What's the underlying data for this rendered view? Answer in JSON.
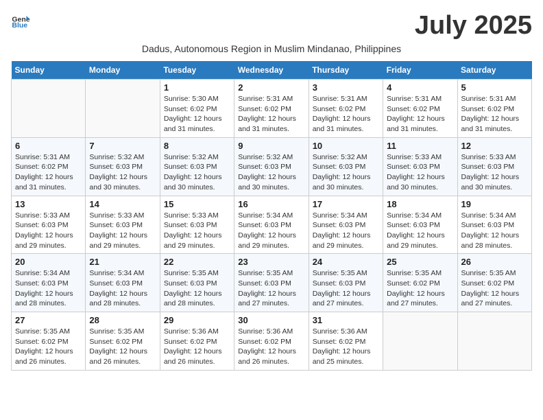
{
  "header": {
    "logo_general": "General",
    "logo_blue": "Blue",
    "title": "July 2025",
    "subtitle": "Dadus, Autonomous Region in Muslim Mindanao, Philippines"
  },
  "days_of_week": [
    "Sunday",
    "Monday",
    "Tuesday",
    "Wednesday",
    "Thursday",
    "Friday",
    "Saturday"
  ],
  "weeks": [
    [
      {
        "day": "",
        "info": ""
      },
      {
        "day": "",
        "info": ""
      },
      {
        "day": "1",
        "info": "Sunrise: 5:30 AM\nSunset: 6:02 PM\nDaylight: 12 hours and 31 minutes."
      },
      {
        "day": "2",
        "info": "Sunrise: 5:31 AM\nSunset: 6:02 PM\nDaylight: 12 hours and 31 minutes."
      },
      {
        "day": "3",
        "info": "Sunrise: 5:31 AM\nSunset: 6:02 PM\nDaylight: 12 hours and 31 minutes."
      },
      {
        "day": "4",
        "info": "Sunrise: 5:31 AM\nSunset: 6:02 PM\nDaylight: 12 hours and 31 minutes."
      },
      {
        "day": "5",
        "info": "Sunrise: 5:31 AM\nSunset: 6:02 PM\nDaylight: 12 hours and 31 minutes."
      }
    ],
    [
      {
        "day": "6",
        "info": "Sunrise: 5:31 AM\nSunset: 6:02 PM\nDaylight: 12 hours and 31 minutes."
      },
      {
        "day": "7",
        "info": "Sunrise: 5:32 AM\nSunset: 6:03 PM\nDaylight: 12 hours and 30 minutes."
      },
      {
        "day": "8",
        "info": "Sunrise: 5:32 AM\nSunset: 6:03 PM\nDaylight: 12 hours and 30 minutes."
      },
      {
        "day": "9",
        "info": "Sunrise: 5:32 AM\nSunset: 6:03 PM\nDaylight: 12 hours and 30 minutes."
      },
      {
        "day": "10",
        "info": "Sunrise: 5:32 AM\nSunset: 6:03 PM\nDaylight: 12 hours and 30 minutes."
      },
      {
        "day": "11",
        "info": "Sunrise: 5:33 AM\nSunset: 6:03 PM\nDaylight: 12 hours and 30 minutes."
      },
      {
        "day": "12",
        "info": "Sunrise: 5:33 AM\nSunset: 6:03 PM\nDaylight: 12 hours and 30 minutes."
      }
    ],
    [
      {
        "day": "13",
        "info": "Sunrise: 5:33 AM\nSunset: 6:03 PM\nDaylight: 12 hours and 29 minutes."
      },
      {
        "day": "14",
        "info": "Sunrise: 5:33 AM\nSunset: 6:03 PM\nDaylight: 12 hours and 29 minutes."
      },
      {
        "day": "15",
        "info": "Sunrise: 5:33 AM\nSunset: 6:03 PM\nDaylight: 12 hours and 29 minutes."
      },
      {
        "day": "16",
        "info": "Sunrise: 5:34 AM\nSunset: 6:03 PM\nDaylight: 12 hours and 29 minutes."
      },
      {
        "day": "17",
        "info": "Sunrise: 5:34 AM\nSunset: 6:03 PM\nDaylight: 12 hours and 29 minutes."
      },
      {
        "day": "18",
        "info": "Sunrise: 5:34 AM\nSunset: 6:03 PM\nDaylight: 12 hours and 29 minutes."
      },
      {
        "day": "19",
        "info": "Sunrise: 5:34 AM\nSunset: 6:03 PM\nDaylight: 12 hours and 28 minutes."
      }
    ],
    [
      {
        "day": "20",
        "info": "Sunrise: 5:34 AM\nSunset: 6:03 PM\nDaylight: 12 hours and 28 minutes."
      },
      {
        "day": "21",
        "info": "Sunrise: 5:34 AM\nSunset: 6:03 PM\nDaylight: 12 hours and 28 minutes."
      },
      {
        "day": "22",
        "info": "Sunrise: 5:35 AM\nSunset: 6:03 PM\nDaylight: 12 hours and 28 minutes."
      },
      {
        "day": "23",
        "info": "Sunrise: 5:35 AM\nSunset: 6:03 PM\nDaylight: 12 hours and 27 minutes."
      },
      {
        "day": "24",
        "info": "Sunrise: 5:35 AM\nSunset: 6:03 PM\nDaylight: 12 hours and 27 minutes."
      },
      {
        "day": "25",
        "info": "Sunrise: 5:35 AM\nSunset: 6:02 PM\nDaylight: 12 hours and 27 minutes."
      },
      {
        "day": "26",
        "info": "Sunrise: 5:35 AM\nSunset: 6:02 PM\nDaylight: 12 hours and 27 minutes."
      }
    ],
    [
      {
        "day": "27",
        "info": "Sunrise: 5:35 AM\nSunset: 6:02 PM\nDaylight: 12 hours and 26 minutes."
      },
      {
        "day": "28",
        "info": "Sunrise: 5:35 AM\nSunset: 6:02 PM\nDaylight: 12 hours and 26 minutes."
      },
      {
        "day": "29",
        "info": "Sunrise: 5:36 AM\nSunset: 6:02 PM\nDaylight: 12 hours and 26 minutes."
      },
      {
        "day": "30",
        "info": "Sunrise: 5:36 AM\nSunset: 6:02 PM\nDaylight: 12 hours and 26 minutes."
      },
      {
        "day": "31",
        "info": "Sunrise: 5:36 AM\nSunset: 6:02 PM\nDaylight: 12 hours and 25 minutes."
      },
      {
        "day": "",
        "info": ""
      },
      {
        "day": "",
        "info": ""
      }
    ]
  ]
}
